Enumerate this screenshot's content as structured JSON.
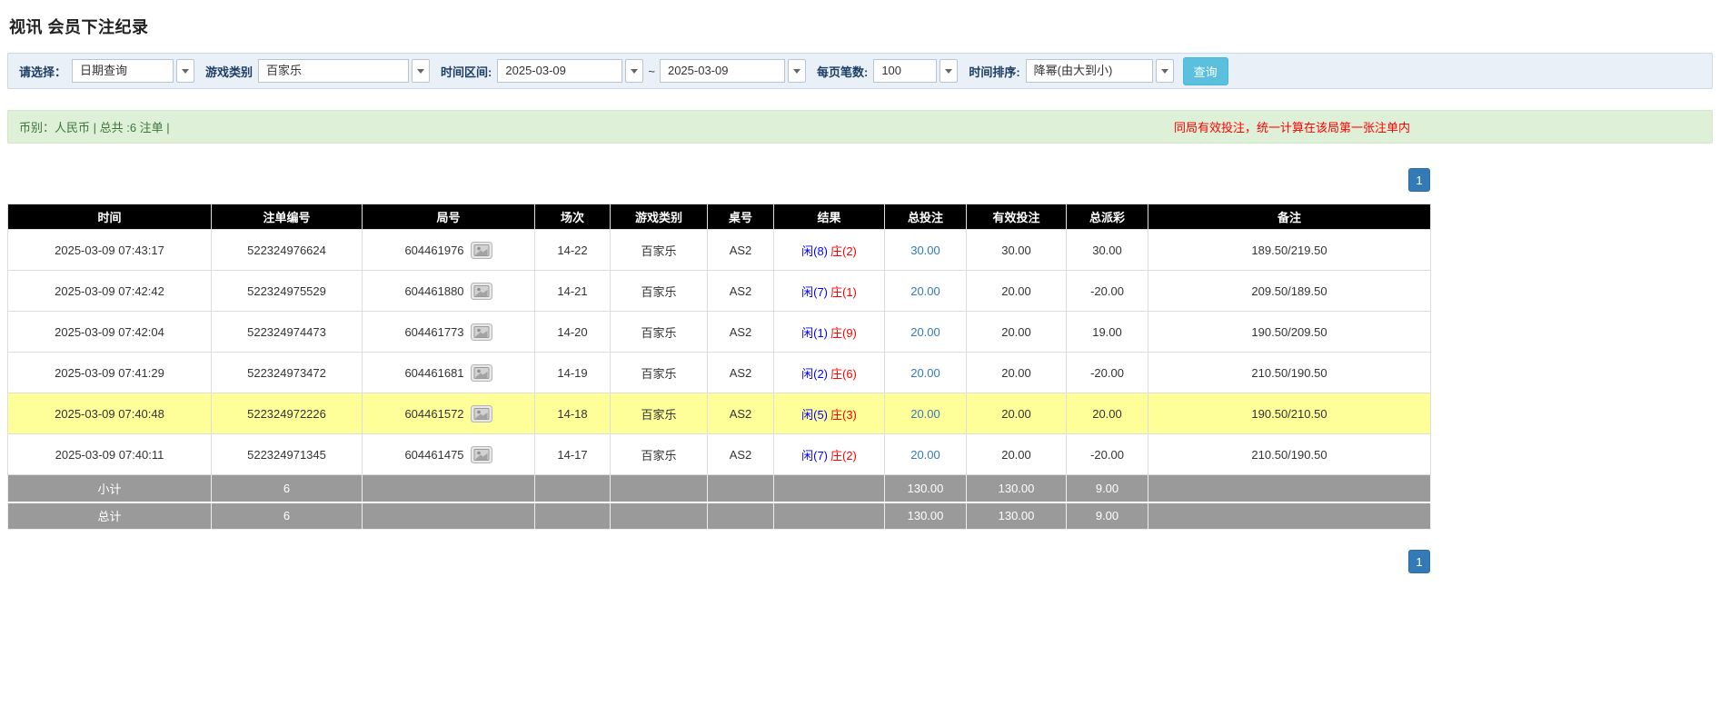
{
  "page": {
    "title": "视讯 会员下注纪录"
  },
  "filter_bar": {
    "select_label": "请选择：",
    "select_value": "日期查询",
    "game_type_label": "游戏类别",
    "game_type_value": "百家乐",
    "time_range_label": "时间区间:",
    "time_from": "2025-03-09",
    "range_separator": "~",
    "time_to": "2025-03-09",
    "page_size_label": "每页笔数:",
    "page_size_value": "100",
    "sort_label": "时间排序:",
    "sort_value": "降幂(由大到小)",
    "search_button_label": "查询"
  },
  "summary_bar": {
    "left_text": "币别：人民币 | 总共 :6 注单 |",
    "right_notice": "同局有效投注，统一计算在该局第一张注单内"
  },
  "pagination": {
    "current_page": "1"
  },
  "colors": {
    "player_blue": "#0000ff",
    "banker_red": "#ff0000",
    "negative_red": "#ff0000",
    "bet_link_blue": "#337ab7",
    "highlight_yellow": "#ffff99",
    "search_button_cyan": "#5bc0de",
    "pagination_blue": "#337ab7",
    "table_header_black": "#000000",
    "summary_footer_gray": "#9a9a9a",
    "summary_bar_green": "#dff0d8",
    "notice_red": "#ff0000"
  },
  "table": {
    "headers": {
      "time": "时间",
      "bet_id": "注单编号",
      "round_id": "局号",
      "session": "场次",
      "game_type": "游戏类别",
      "table_no": "桌号",
      "result": "结果",
      "total_bet": "总投注",
      "valid_bet": "有效投注",
      "total_payout": "总派彩",
      "note": "备注"
    },
    "rows": [
      {
        "time": "2025-03-09 07:43:17",
        "bet_id": "522324976624",
        "round_id": "604461976",
        "session": "14-22",
        "game_type": "百家乐",
        "table_no": "AS2",
        "result_player": "闲(8)",
        "result_banker": "庄(2)",
        "total_bet": "30.00",
        "valid_bet": "30.00",
        "payout": "30.00",
        "note": "189.50/219.50",
        "highlight": false
      },
      {
        "time": "2025-03-09 07:42:42",
        "bet_id": "522324975529",
        "round_id": "604461880",
        "session": "14-21",
        "game_type": "百家乐",
        "table_no": "AS2",
        "result_player": "闲(7)",
        "result_banker": "庄(1)",
        "total_bet": "20.00",
        "valid_bet": "20.00",
        "payout": "-20.00",
        "note": "209.50/189.50",
        "highlight": false
      },
      {
        "time": "2025-03-09 07:42:04",
        "bet_id": "522324974473",
        "round_id": "604461773",
        "session": "14-20",
        "game_type": "百家乐",
        "table_no": "AS2",
        "result_player": "闲(1)",
        "result_banker": "庄(9)",
        "total_bet": "20.00",
        "valid_bet": "20.00",
        "payout": "19.00",
        "note": "190.50/209.50",
        "highlight": false
      },
      {
        "time": "2025-03-09 07:41:29",
        "bet_id": "522324973472",
        "round_id": "604461681",
        "session": "14-19",
        "game_type": "百家乐",
        "table_no": "AS2",
        "result_player": "闲(2)",
        "result_banker": "庄(6)",
        "total_bet": "20.00",
        "valid_bet": "20.00",
        "payout": "-20.00",
        "note": "210.50/190.50",
        "highlight": false
      },
      {
        "time": "2025-03-09 07:40:48",
        "bet_id": "522324972226",
        "round_id": "604461572",
        "session": "14-18",
        "game_type": "百家乐",
        "table_no": "AS2",
        "result_player": "闲(5)",
        "result_banker": "庄(3)",
        "total_bet": "20.00",
        "valid_bet": "20.00",
        "payout": "20.00",
        "note": "190.50/210.50",
        "highlight": true
      },
      {
        "time": "2025-03-09 07:40:11",
        "bet_id": "522324971345",
        "round_id": "604461475",
        "session": "14-17",
        "game_type": "百家乐",
        "table_no": "AS2",
        "result_player": "闲(7)",
        "result_banker": "庄(2)",
        "total_bet": "20.00",
        "valid_bet": "20.00",
        "payout": "-20.00",
        "note": "210.50/190.50",
        "highlight": false
      }
    ],
    "subtotal_row": {
      "label": "小计",
      "count": "6",
      "total_bet": "130.00",
      "valid_bet": "130.00",
      "payout": "9.00"
    },
    "total_row": {
      "label": "总计",
      "count": "6",
      "total_bet": "130.00",
      "valid_bet": "130.00",
      "payout": "9.00"
    }
  }
}
